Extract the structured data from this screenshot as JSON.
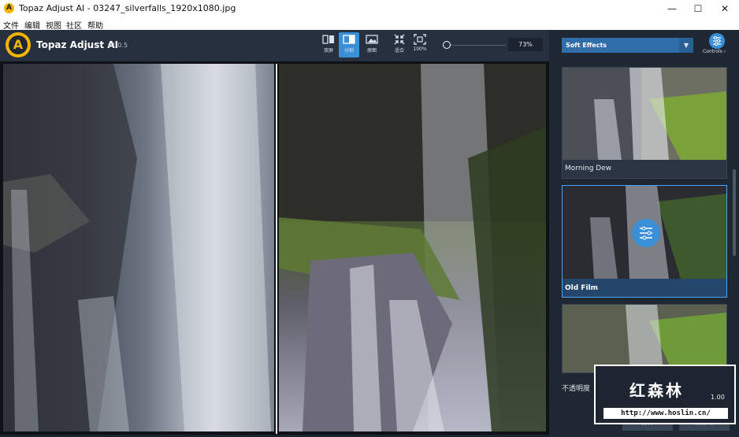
{
  "window": {
    "title": "Topaz Adjust AI - 03247_silverfalls_1920x1080.jpg",
    "app_icon": "A"
  },
  "menu": [
    "文件",
    "编辑",
    "视图",
    "社区",
    "帮助"
  ],
  "toolbar": {
    "brand": "Topaz Adjust AI",
    "version": "v1.0.5",
    "logo_letter": "A",
    "view_buttons": [
      {
        "label": "双屏",
        "icon": "dual-view-icon"
      },
      {
        "label": "分割",
        "icon": "split-view-icon"
      },
      {
        "label": "原图",
        "icon": "original-view-icon"
      }
    ],
    "fit_button": {
      "label": "适合",
      "icon": "fit-icon"
    },
    "actual_button": {
      "label": "100%",
      "icon": "actual-size-icon"
    },
    "zoom_value": "73%"
  },
  "panel": {
    "effects_category": "Soft Effects",
    "controls_label": "Controls ›",
    "effects": [
      {
        "name": "Morning Dew",
        "selected": false
      },
      {
        "name": "Old Film",
        "selected": true
      },
      {
        "name": "",
        "selected": false
      }
    ],
    "opacity_label": "不透明度",
    "opacity_value": "1.00",
    "buttons": {
      "open": "打开",
      "save_as": "另存为"
    }
  },
  "watermark": {
    "text": "红森林",
    "url": "http://www.hoslin.cn/"
  },
  "colors": {
    "accent": "#3a8fd6",
    "toolbar_bg": "#26303f",
    "panel_bg": "#1f2733",
    "logo": "#f2b400"
  }
}
